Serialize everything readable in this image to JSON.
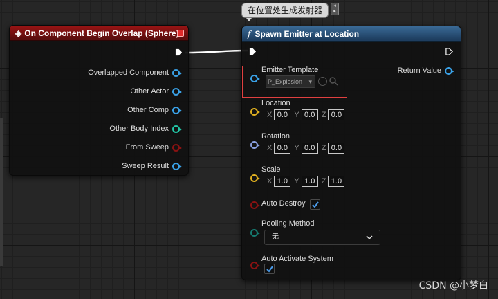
{
  "tooltip": {
    "label": "在位置处生成发射器"
  },
  "event_node": {
    "title": "On Component Begin Overlap (Sphere)",
    "outputs": [
      {
        "label": "Overlapped Component",
        "pin": "object-blue"
      },
      {
        "label": "Other Actor",
        "pin": "object-blue"
      },
      {
        "label": "Other Comp",
        "pin": "object-blue"
      },
      {
        "label": "Other Body Index",
        "pin": "integer-teal"
      },
      {
        "label": "From Sweep",
        "pin": "bool-red"
      },
      {
        "label": "Sweep Result",
        "pin": "struct-blue"
      }
    ]
  },
  "func_node": {
    "title": "Spawn Emitter at Location",
    "return_value": "Return Value",
    "emitter_template": {
      "label": "Emitter Template",
      "value": "P_Explosion"
    },
    "location": {
      "label": "Location",
      "x": "0.0",
      "y": "0.0",
      "z": "0.0"
    },
    "rotation": {
      "label": "Rotation",
      "x": "0.0",
      "y": "0.0",
      "z": "0.0"
    },
    "scale": {
      "label": "Scale",
      "x": "1.0",
      "y": "1.0",
      "z": "1.0"
    },
    "auto_destroy": {
      "label": "Auto Destroy",
      "checked": true
    },
    "pooling_method": {
      "label": "Pooling Method",
      "value": "无"
    },
    "auto_activate": {
      "label": "Auto Activate System",
      "checked": true
    },
    "axis_labels": {
      "x": "X",
      "y": "Y",
      "z": "Z"
    }
  },
  "watermark": "CSDN @小梦白",
  "colors": {
    "event_header": "#9b1414",
    "func_header": "#3a6a96",
    "highlight": "#e04040",
    "pin_object": "#3aa2e8",
    "pin_integer": "#22c8a8",
    "pin_bool": "#8a1212",
    "pin_vector": "#e0b020",
    "pin_rotator": "#8aa0e0"
  }
}
